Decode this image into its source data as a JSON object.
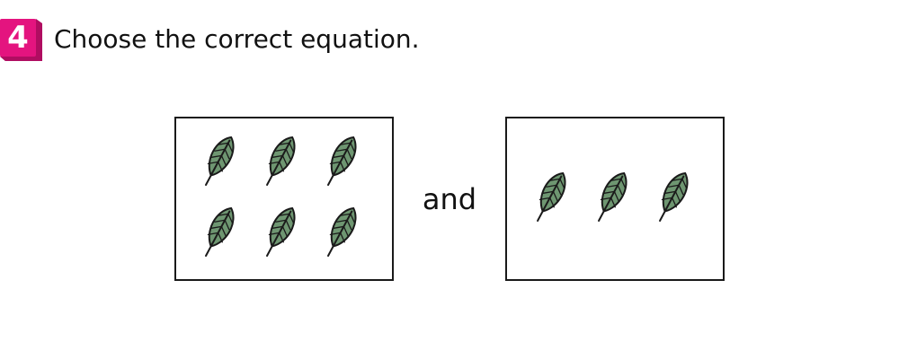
{
  "question": {
    "number": "4",
    "text": "Choose the correct equation."
  },
  "connector": "and",
  "groups": [
    {
      "item": "leaf-icon",
      "count": 6
    },
    {
      "item": "leaf-icon",
      "count": 3
    }
  ],
  "colors": {
    "badge": "#e4147f",
    "badge_shadow": "#b00d61",
    "leaf_fill": "#6e9671",
    "outline": "#1a1a1a"
  }
}
